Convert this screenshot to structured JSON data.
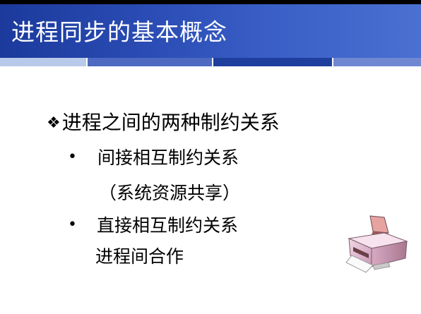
{
  "slide": {
    "title": "进程同步的基本概念",
    "main_point": {
      "marker": "❖",
      "text": "进程之间的两种制约关系"
    },
    "items": [
      {
        "bullet": "•",
        "label": "间接相互制约关系",
        "note": "（系统资源共享）"
      },
      {
        "bullet": "•",
        "label": "直接相互制约关系",
        "note": "进程间合作"
      }
    ],
    "illustration_icon": "printer-icon"
  }
}
